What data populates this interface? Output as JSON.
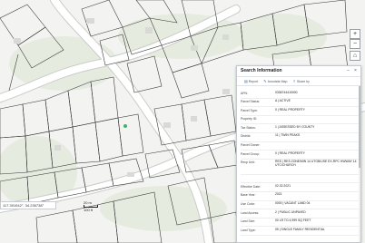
{
  "map": {
    "coordinates": "117.391942°, 34.235738°",
    "scale": {
      "top": "20 m",
      "bottom": "100 ft"
    },
    "controls": [
      "+",
      "−",
      "⌂",
      "⛶"
    ]
  },
  "panel": {
    "title": "Search Information",
    "toolbar": {
      "report": "Report",
      "annotate": "Annotate Map",
      "share": "Share by"
    },
    "rows": [
      {
        "label": "APN:",
        "value": "0336744410000"
      },
      {
        "label": "Parcel Status:",
        "value": "A | ACTIVE"
      },
      {
        "label": "Parcel Type:",
        "value": "0 | REAL PROPERTY"
      },
      {
        "label": "Property ID:",
        "value": ""
      },
      {
        "label": "Tax Status:",
        "value": "1 | ASSESSED BY COUNTY"
      },
      {
        "label": "District:",
        "value": "11 | TWIN PEAKS"
      },
      {
        "label": "Parcel Owner:",
        "value": ""
      },
      {
        "label": "Parcel Group:",
        "value": "0 | REAL PROPERTY"
      },
      {
        "label": "Recp Unit:",
        "value": "RES | RES ZONE/MIN 14 UTGB/USE EX-RPC HWWAY 14 UTC/CHURCH"
      },
      {
        "label": "",
        "value": ""
      },
      {
        "label": "Effective Date:",
        "value": "02.02.2021"
      },
      {
        "label": "Base Year:",
        "value": "2021"
      },
      {
        "label": "Use Code:",
        "value": "0000 | VACANT LAND 04"
      },
      {
        "label": "Land Access:",
        "value": "2 | PUBLIC UNPAVED"
      },
      {
        "label": "Land Size:",
        "value": "00 LR TO 4,999 SQ FEET"
      },
      {
        "label": "Land Type:",
        "value": "05 | SINGLE FAMILY RESIDENTIAL"
      }
    ]
  },
  "colors": {
    "map_bg": "#f3f4f1",
    "parcel_line": "#3a3a3a",
    "road_fill": "#ffffff",
    "selected_point": "#3db36b"
  }
}
